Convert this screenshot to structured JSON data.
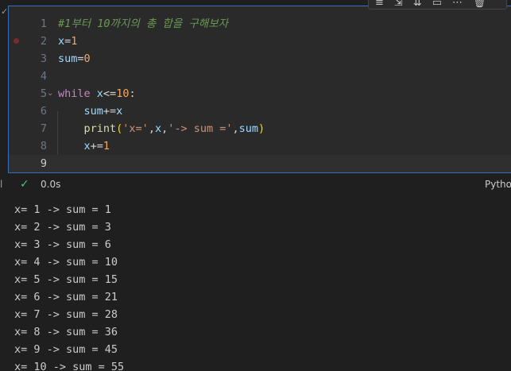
{
  "cell": {
    "toolbar": {
      "icons": [
        "run-by-line-icon",
        "execute-above-icon",
        "execute-below-icon",
        "split-cell-icon",
        "more-icon",
        "delete-icon"
      ],
      "glyphs": [
        "≡",
        "⇲",
        "⇊",
        "▭",
        "⋯",
        "🗑"
      ]
    },
    "edge_mark": "✓",
    "lines": [
      {
        "num": "1",
        "tokens": [
          {
            "t": "#1부터 10까지의 총 합을 구해보자",
            "c": "comment"
          }
        ]
      },
      {
        "num": "2",
        "tokens": [
          {
            "t": "x",
            "c": "var"
          },
          {
            "t": "=",
            "c": "op"
          },
          {
            "t": "1",
            "c": "num"
          }
        ]
      },
      {
        "num": "3",
        "tokens": [
          {
            "t": "sum",
            "c": "var"
          },
          {
            "t": "=",
            "c": "op"
          },
          {
            "t": "0",
            "c": "num"
          }
        ]
      },
      {
        "num": "4",
        "tokens": []
      },
      {
        "num": "5",
        "tokens": [
          {
            "t": "while",
            "c": "kw"
          },
          {
            "t": " ",
            "c": "op"
          },
          {
            "t": "x",
            "c": "var"
          },
          {
            "t": "<=",
            "c": "op"
          },
          {
            "t": "10",
            "c": "num"
          },
          {
            "t": ":",
            "c": "punc"
          }
        ]
      },
      {
        "num": "6",
        "tokens": [
          {
            "t": "    ",
            "c": "op"
          },
          {
            "t": "sum",
            "c": "var"
          },
          {
            "t": "+=",
            "c": "op"
          },
          {
            "t": "x",
            "c": "var"
          }
        ]
      },
      {
        "num": "7",
        "tokens": [
          {
            "t": "    ",
            "c": "op"
          },
          {
            "t": "print",
            "c": "fn"
          },
          {
            "t": "(",
            "c": "paren"
          },
          {
            "t": "'x='",
            "c": "str"
          },
          {
            "t": ",",
            "c": "punc"
          },
          {
            "t": "x",
            "c": "var"
          },
          {
            "t": ",",
            "c": "punc"
          },
          {
            "t": "'-> sum ='",
            "c": "str"
          },
          {
            "t": ",",
            "c": "punc"
          },
          {
            "t": "sum",
            "c": "var"
          },
          {
            "t": ")",
            "c": "paren"
          }
        ]
      },
      {
        "num": "8",
        "tokens": [
          {
            "t": "    ",
            "c": "op"
          },
          {
            "t": "x",
            "c": "var"
          },
          {
            "t": "+=",
            "c": "op"
          },
          {
            "t": "1",
            "c": "num"
          }
        ]
      },
      {
        "num": "9",
        "tokens": []
      }
    ],
    "breakpoint_line": "2",
    "fold_line": "5",
    "active_line": "9",
    "fold_glyph": "⌄"
  },
  "status": {
    "left_mark": "l",
    "check_glyph": "✓",
    "exec_time": "0.0s",
    "language": "Python"
  },
  "output": [
    "x= 1 -> sum = 1",
    "x= 2 -> sum = 3",
    "x= 3 -> sum = 6",
    "x= 4 -> sum = 10",
    "x= 5 -> sum = 15",
    "x= 6 -> sum = 21",
    "x= 7 -> sum = 28",
    "x= 8 -> sum = 36",
    "x= 9 -> sum = 45",
    "x= 10 -> sum = 55"
  ],
  "colors": {
    "accent": "#3b6fb6",
    "success": "#4ec07b",
    "breakpoint": "#7a2a2a"
  }
}
